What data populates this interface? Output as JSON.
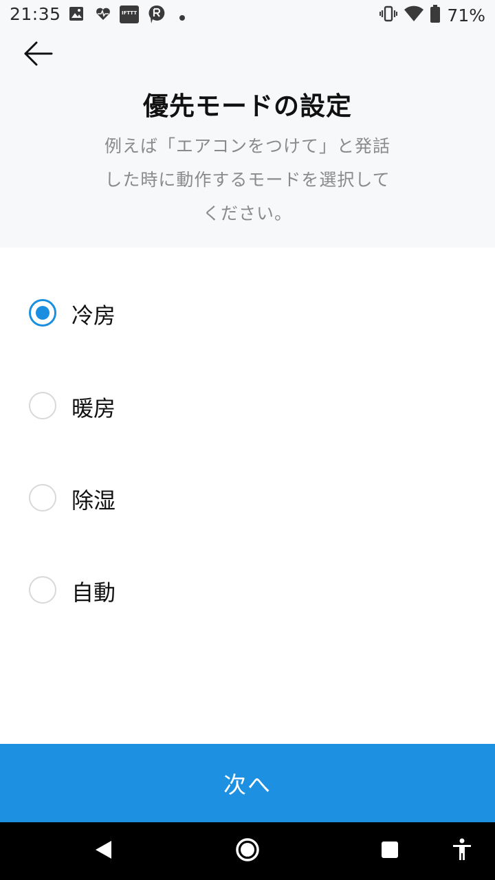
{
  "status_bar": {
    "time": "21:35",
    "notification_icons": [
      "image-icon",
      "heart-pulse-icon",
      "ifttt-icon",
      "r-chat-icon",
      "dot-icon"
    ],
    "ifttt_label": "IFTTT",
    "status_icons": [
      "vibrate-icon",
      "wifi-icon",
      "battery-icon"
    ],
    "battery_percent": "71%"
  },
  "header": {
    "back_icon": "arrow-left-icon",
    "title": "優先モードの設定",
    "description": "例えば「エアコンをつけて」と発話した時に動作するモードを選択してください。"
  },
  "options": [
    {
      "label": "冷房",
      "selected": true
    },
    {
      "label": "暖房",
      "selected": false
    },
    {
      "label": "除湿",
      "selected": false
    },
    {
      "label": "自動",
      "selected": false
    }
  ],
  "next_button": {
    "label": "次へ"
  },
  "nav_bar": {
    "icons": [
      "back-triangle-icon",
      "home-circle-icon",
      "recents-square-icon",
      "accessibility-icon"
    ]
  },
  "colors": {
    "accent": "#1e90e2",
    "radio_selected": "#1a8fe0",
    "header_bg": "#f7f8fa",
    "description_text": "#8a8a8a"
  }
}
